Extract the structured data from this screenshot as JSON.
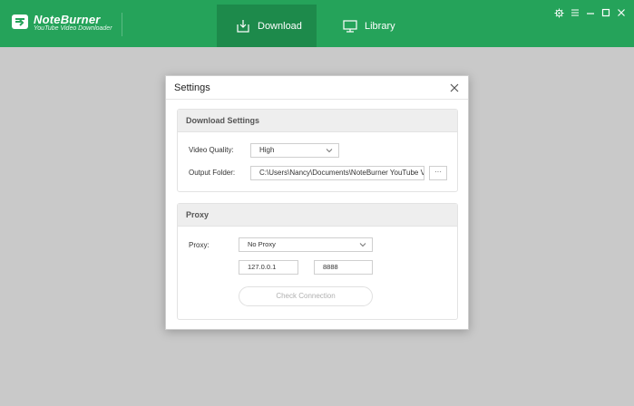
{
  "app": {
    "name": "NoteBurner",
    "subtitle": "YouTube Video Downloader",
    "brand_color": "#25a35a",
    "active_tab_color": "#1d8a4b"
  },
  "nav": {
    "tabs": [
      {
        "label": "Download",
        "icon": "download-icon",
        "active": true
      },
      {
        "label": "Library",
        "icon": "monitor-icon",
        "active": false
      }
    ]
  },
  "window_controls": {
    "settings_icon": "gear-icon",
    "menu_icon": "menu-icon",
    "minimize_icon": "minimize-icon",
    "maximize_icon": "maximize-icon",
    "close_icon": "close-icon"
  },
  "dialog": {
    "title": "Settings",
    "download_settings": {
      "heading": "Download Settings",
      "video_quality_label": "Video Quality:",
      "video_quality_value": "High",
      "output_folder_label": "Output Folder:",
      "output_folder_value": "C:\\Users\\Nancy\\Documents\\NoteBurner YouTube Video Downloader",
      "browse_label": "···"
    },
    "proxy": {
      "heading": "Proxy",
      "proxy_label": "Proxy:",
      "proxy_value": "No Proxy",
      "host_value": "127.0.0.1",
      "port_value": "8888",
      "check_label": "Check Connection"
    }
  }
}
